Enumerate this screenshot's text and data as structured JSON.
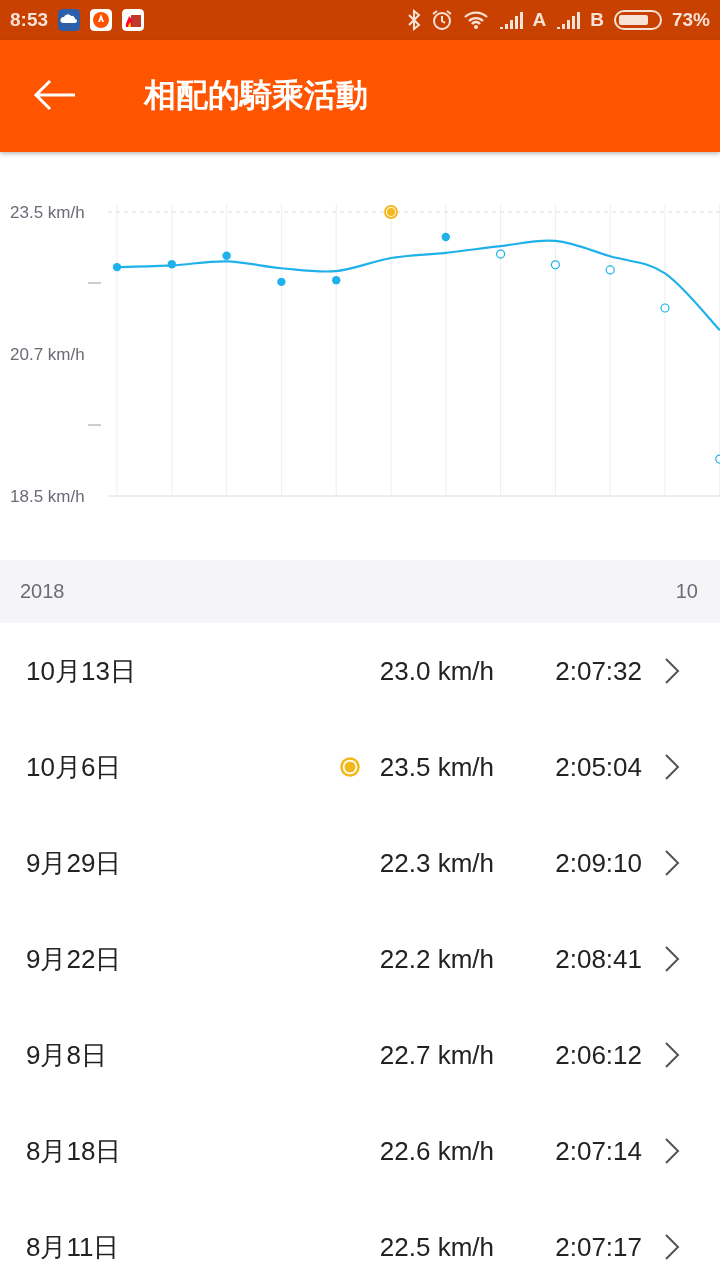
{
  "status_bar": {
    "time": "8:53",
    "sim_1": "A",
    "sim_2": "B",
    "battery": "73%"
  },
  "app_bar": {
    "title": "相配的騎乘活動"
  },
  "speed_chart": {
    "middle_label": "20.7 km/h",
    "chart_data": {
      "type": "scatter",
      "grid": true,
      "ylim": [
        18.5,
        23.5
      ],
      "yticks": [
        {
          "value": 23.5,
          "label": "23.5 km/h"
        },
        {
          "value": 18.5,
          "label": "18.5 km/h"
        }
      ],
      "series": [
        {
          "type": "line",
          "color": "#1fb1ea",
          "values": [
            22.53,
            22.56,
            22.63,
            22.51,
            22.46,
            22.69,
            22.78,
            22.9,
            22.99,
            22.72,
            22.42,
            21.42
          ]
        },
        {
          "type": "scatter",
          "marker": "circle",
          "color": "#1fb1ea",
          "values": [
            22.53,
            22.58,
            22.73,
            22.27,
            22.3,
            null,
            23.06,
            null,
            null,
            null,
            null,
            null
          ]
        },
        {
          "type": "scatter",
          "marker": "circle",
          "color": "#f5b81c",
          "values": [
            null,
            null,
            null,
            null,
            null,
            23.5,
            null,
            null,
            null,
            null,
            null,
            null
          ]
        },
        {
          "type": "scatter",
          "marker": "circle",
          "color": "#1fb1ea",
          "values": [
            null,
            null,
            null,
            null,
            null,
            null,
            null,
            22.76,
            22.57,
            22.48,
            21.81,
            19.15
          ]
        }
      ]
    }
  },
  "list_header": {
    "year": "2018",
    "month": "10"
  },
  "rides": [
    {
      "date": "10月13日",
      "best": false,
      "speed": "23.0 km/h",
      "duration": "2:07:32"
    },
    {
      "date": "10月6日",
      "best": true,
      "speed": "23.5 km/h",
      "duration": "2:05:04"
    },
    {
      "date": "9月29日",
      "best": false,
      "speed": "22.3 km/h",
      "duration": "2:09:10"
    },
    {
      "date": "9月22日",
      "best": false,
      "speed": "22.2 km/h",
      "duration": "2:08:41"
    },
    {
      "date": "9月8日",
      "best": false,
      "speed": "22.7 km/h",
      "duration": "2:06:12"
    },
    {
      "date": "8月18日",
      "best": false,
      "speed": "22.6 km/h",
      "duration": "2:07:14"
    },
    {
      "date": "8月11日",
      "best": false,
      "speed": "22.5 km/h",
      "duration": "2:07:17"
    }
  ]
}
